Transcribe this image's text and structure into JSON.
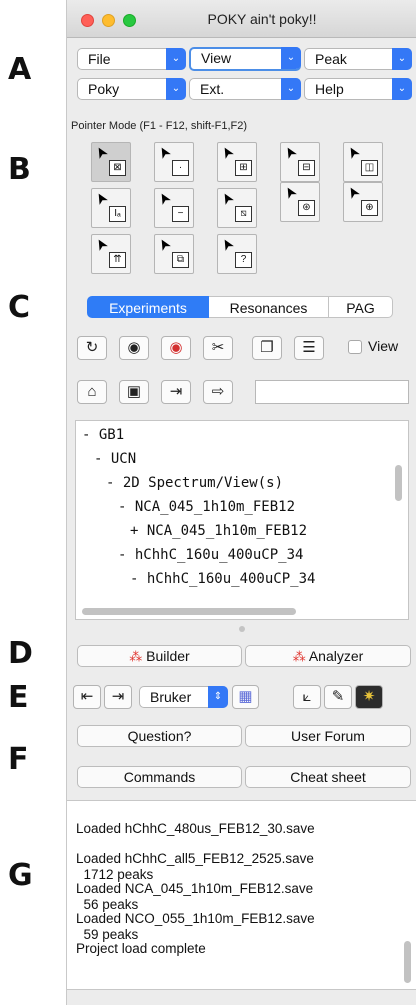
{
  "section_letters": [
    "A",
    "B",
    "C",
    "D",
    "E",
    "F",
    "G"
  ],
  "window": {
    "title": "POKY ain't poky!!"
  },
  "menus": [
    {
      "label": "File"
    },
    {
      "label": "View",
      "active": true
    },
    {
      "label": "Peak"
    },
    {
      "label": "Poky"
    },
    {
      "label": "Ext."
    },
    {
      "label": "Help"
    }
  ],
  "pointer_mode": {
    "label": "Pointer Mode (F1 - F12, shift-F1,F2)",
    "buttons": [
      {
        "icon": "select-box-icon",
        "glyph": "⊠",
        "selected": true
      },
      {
        "icon": "select-small-icon",
        "glyph": "·"
      },
      {
        "icon": "grid-cross-icon",
        "glyph": "⊞"
      },
      {
        "icon": "horizontal-split-icon",
        "glyph": "⊟"
      },
      {
        "icon": "vertical-split-icon",
        "glyph": "◫"
      },
      {
        "icon": "integrate-icon",
        "glyph": "Iₐ"
      },
      {
        "icon": "minus-box-icon",
        "glyph": "−"
      },
      {
        "icon": "diagonal-icon",
        "glyph": "⧅"
      },
      {
        "icon": "peak-center-icon",
        "glyph": "⊛"
      },
      {
        "icon": "zoom-box-icon",
        "glyph": "⊕"
      },
      {
        "icon": "link-arrows-icon",
        "glyph": "⇈"
      },
      {
        "icon": "copy-box-icon",
        "glyph": "⧉"
      },
      {
        "icon": "help-box-icon",
        "glyph": "?"
      }
    ]
  },
  "tabs": [
    {
      "label": "Experiments",
      "active": true
    },
    {
      "label": "Resonances"
    },
    {
      "label": "PAG"
    }
  ],
  "toolbar_row1": [
    {
      "icon": "refresh-icon",
      "glyph": "↻"
    },
    {
      "icon": "eye-icon",
      "glyph": "◉"
    },
    {
      "icon": "eye-red-icon",
      "glyph": "◉"
    },
    {
      "icon": "tools-icon",
      "glyph": "✂"
    },
    {
      "icon": "duplicate-icon",
      "glyph": "❐"
    },
    {
      "icon": "list-icon",
      "glyph": "☰"
    }
  ],
  "view_checkbox": {
    "label": "View",
    "checked": false
  },
  "toolbar_row2": [
    {
      "icon": "open-folder-icon",
      "glyph": "⌂"
    },
    {
      "icon": "save-icon",
      "glyph": "▣"
    },
    {
      "icon": "import-icon",
      "glyph": "⇥"
    },
    {
      "icon": "export-icon",
      "glyph": "⇨"
    }
  ],
  "filter_input": {
    "value": "",
    "placeholder": ""
  },
  "tree": [
    {
      "text": "- GB1",
      "indent": 0
    },
    {
      "text": "- UCN",
      "indent": 1
    },
    {
      "text": "- 2D Spectrum/View(s)",
      "indent": 2
    },
    {
      "text": "- NCA_045_1h10m_FEB12",
      "indent": 3
    },
    {
      "text": "+ NCA_045_1h10m_FEB12",
      "indent": 4
    },
    {
      "text": "- hChhC_160u_400uCP_34",
      "indent": 3
    },
    {
      "text": "- hChhC_160u_400uCP_34",
      "indent": 4
    }
  ],
  "builder_button": {
    "label": "Builder",
    "icon": "builder-icon"
  },
  "analyzer_button": {
    "label": "Analyzer",
    "icon": "analyzer-icon"
  },
  "format_select": {
    "value": "Bruker"
  },
  "row_e_icons": [
    {
      "icon": "import-left-icon",
      "glyph": "⇤"
    },
    {
      "icon": "import-right-icon",
      "glyph": "⇥"
    },
    {
      "icon": "spectrum-preview-icon",
      "glyph": "▦"
    },
    {
      "icon": "plot-axes-icon",
      "glyph": "⟀"
    },
    {
      "icon": "edit-note-icon",
      "glyph": "✎"
    },
    {
      "icon": "structure-icon",
      "glyph": "✷"
    }
  ],
  "help_buttons": [
    {
      "label": "Question?"
    },
    {
      "label": "User Forum"
    },
    {
      "label": "Commands"
    },
    {
      "label": "Cheat sheet"
    }
  ],
  "log": [
    "Loaded hChhC_480us_FEB12_30.save",
    "",
    "Loaded hChhC_all5_FEB12_2525.save",
    "  1712 peaks",
    "Loaded NCA_045_1h10m_FEB12.save",
    "  56 peaks",
    "Loaded NCO_055_1h10m_FEB12.save",
    "  59 peaks",
    "Project load complete"
  ],
  "colors": {
    "accent": "#2f7cf6",
    "red_dot": "#ff5f57",
    "yellow_dot": "#febc2e",
    "green_dot": "#28c840"
  }
}
